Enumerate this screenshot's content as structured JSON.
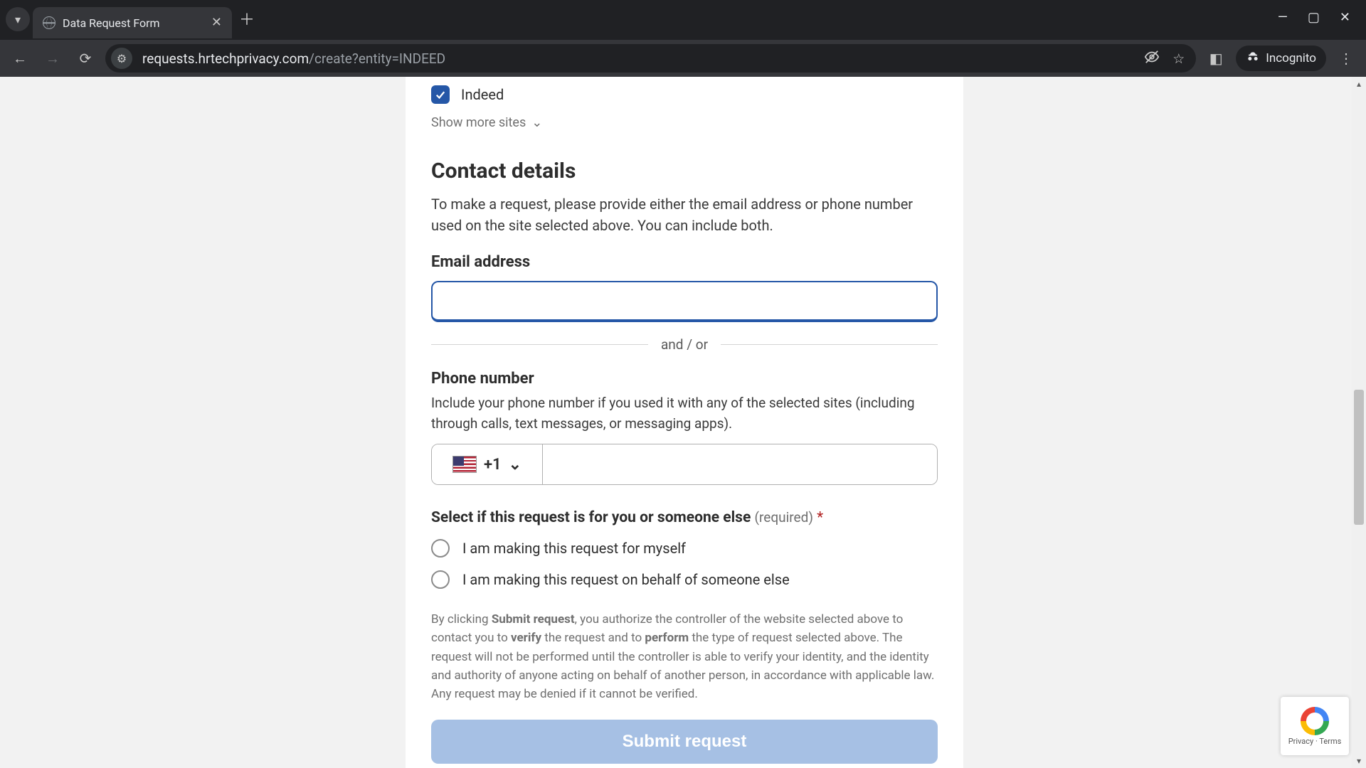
{
  "browser": {
    "tab_title": "Data Request Form",
    "url_host": "requests.hrtechprivacy.com",
    "url_path": "/create?entity=INDEED",
    "incognito_label": "Incognito"
  },
  "form": {
    "site_checkbox_label": "Indeed",
    "show_more_label": "Show more sites",
    "contact_heading": "Contact details",
    "contact_desc": "To make a request, please provide either the email address or phone number used on the site selected above. You can include both.",
    "email_label": "Email address",
    "email_value": "",
    "divider_text": "and / or",
    "phone_label": "Phone number",
    "phone_helper": "Include your phone number if you used it with any of the selected sites (including through calls, text messages, or messaging apps).",
    "phone_country_code": "+1",
    "phone_value": "",
    "requester_label": "Select if this request is for you or someone else",
    "requester_required": "(required)",
    "requester_star": "*",
    "radio_self": "I am making this request for myself",
    "radio_other": "I am making this request on behalf of someone else",
    "legal_prefix": "By clicking ",
    "legal_bold1": "Submit request",
    "legal_mid1": ", you authorize the controller of the website selected above to contact you to ",
    "legal_bold2": "verify",
    "legal_mid2": " the request and to ",
    "legal_bold3": "perform",
    "legal_suffix": " the type of request selected above. The request will not be performed until the controller is able to verify your identity, and the identity and authority of anyone acting on behalf of another person, in accordance with applicable law. Any request may be denied if it cannot be verified.",
    "submit_label": "Submit request"
  },
  "recaptcha": {
    "line": "Privacy · Terms"
  }
}
